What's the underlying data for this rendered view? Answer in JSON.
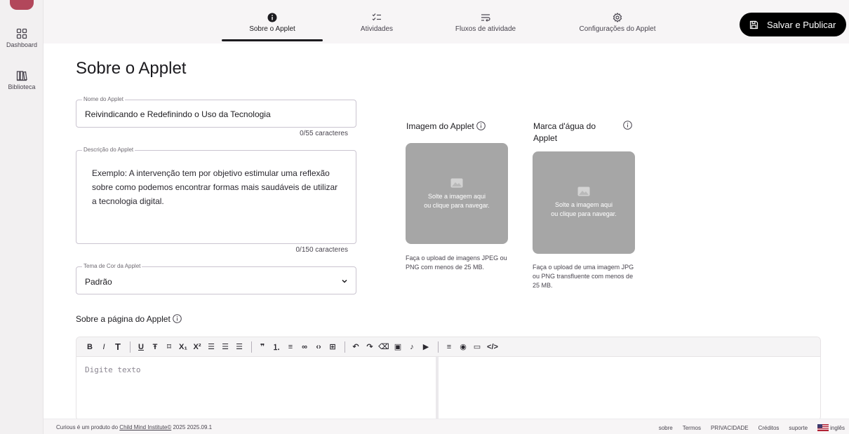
{
  "sidebar": {
    "items": [
      {
        "label": "Dashboard",
        "icon": "dashboard-grid-icon"
      },
      {
        "label": "Biblioteca",
        "icon": "library-icon"
      }
    ]
  },
  "header": {
    "tabs": [
      {
        "label": "Sobre o Applet",
        "icon": "info-filled-icon",
        "active": true
      },
      {
        "label": "Atividades",
        "icon": "checklist-icon"
      },
      {
        "label": "Fluxos de atividade",
        "icon": "flow-icon"
      },
      {
        "label": "Configurações do Applet",
        "icon": "gear-icon"
      }
    ],
    "publish_label": "Salvar e Publicar"
  },
  "main": {
    "title": "Sobre o Applet",
    "name_field": {
      "label": "Nome do Applet",
      "value": "Reivindicando e Redefinindo o Uso da Tecnologia",
      "counter": "0/55 caracteres"
    },
    "description_field": {
      "label": "Descrição do Applet",
      "value": "Exemplo: A intervenção tem por objetivo estimular uma reflexão sobre como podemos encontrar formas mais saudáveis de utilizar a tecnologia digital.",
      "counter": "0/150 caracteres"
    },
    "theme_field": {
      "label": "Tema de Cor da Applet",
      "value": "Padrão"
    },
    "applet_image": {
      "title": "Imagem do Applet",
      "drop_line1": "Solte a imagem aqui",
      "drop_line2": "ou clique para navegar.",
      "hint": "Faça o upload de imagens JPEG ou PNG com menos de 25 MB."
    },
    "watermark": {
      "title": "Marca d'água do Applet",
      "drop_line1": "Solte a imagem aqui",
      "drop_line2": "ou clique para navegar.",
      "hint": "Faça o upload de uma imagem JPG ou PNG transfluente com menos de 25 MB."
    },
    "about_page_title": "Sobre a página do Applet",
    "editor_placeholder": "Digite texto"
  },
  "toolbar": {
    "bold": "B",
    "italic": "I",
    "heading": "T",
    "underline": "U",
    "strike": "Ŧ",
    "mark": "⌑",
    "subscript": "X₁",
    "superscript": "X²",
    "quote": "❞",
    "ordered_list": "⒈",
    "bullet_list": "≡",
    "link": "∞",
    "code": "‹›",
    "table": "⊞",
    "undo": "↶",
    "redo": "↷",
    "clear": "⌫",
    "image": "▣",
    "audio": "♪",
    "video": "▶",
    "align": "≡",
    "preview": "◉",
    "fullscreen": "▭",
    "source": "</>"
  },
  "footer": {
    "prefix": "Curious é um produto do",
    "link": "Child Mind Institute©",
    "version": "2025 2025.09.1",
    "links": [
      "sobre",
      "Termos",
      "PRIVACIDADE",
      "Créditos",
      "suporte"
    ],
    "language": "inglês"
  },
  "colors": {
    "accent": "#b2475b",
    "primary_button": "#000000",
    "dropzone": "#a6a6a6"
  }
}
